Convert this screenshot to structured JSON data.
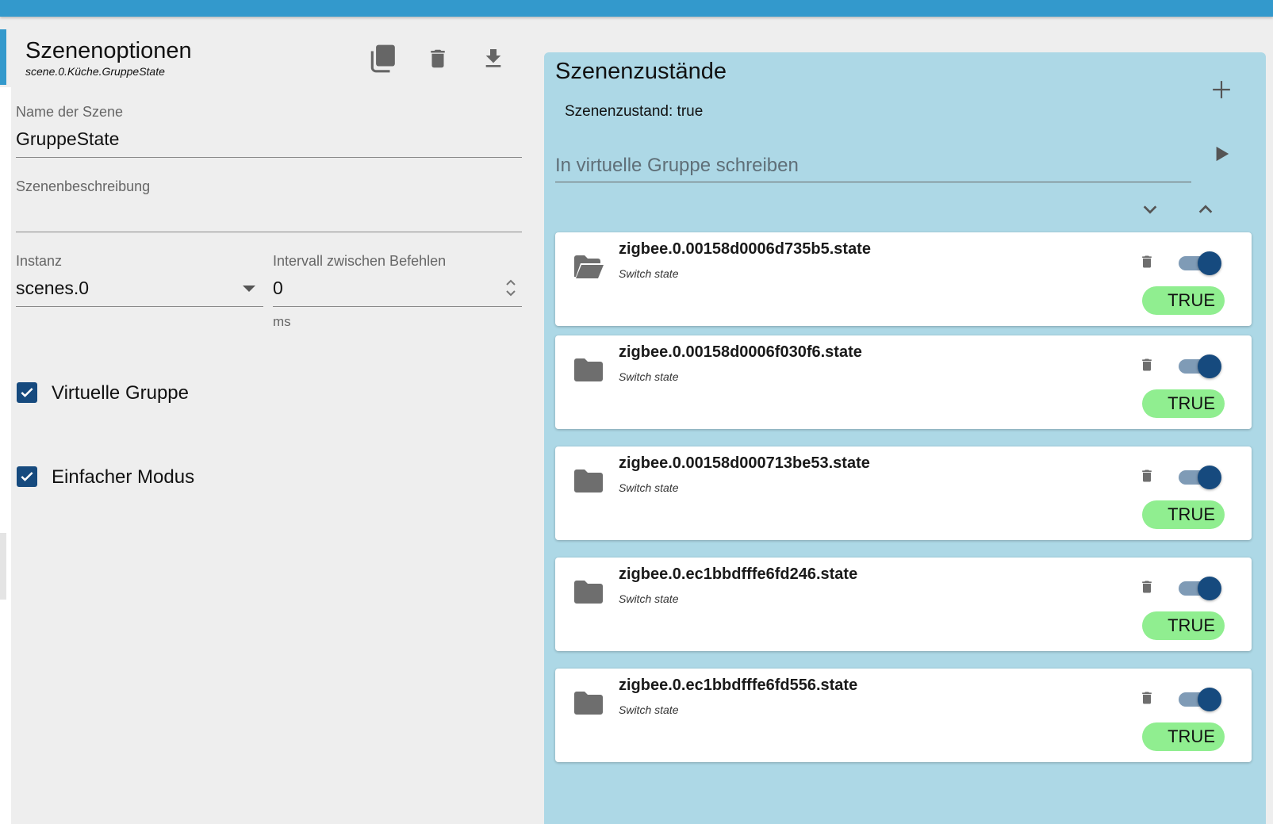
{
  "colors": {
    "topbar": "#3399cc",
    "right_panel_bg": "#add8e6",
    "accent_dark": "#164a7e",
    "true_badge": "#90ee90",
    "page_bg": "#eeeeee"
  },
  "scene_options": {
    "title": "Szenenoptionen",
    "scene_id": "scene.0.Küche.GruppeState",
    "toolbar_icons": [
      "copy-icon",
      "delete-icon",
      "download-icon"
    ],
    "name_label": "Name der Szene",
    "name_value": "GruppeState",
    "description_label": "Szenenbeschreibung",
    "description_value": "",
    "instance_label": "Instanz",
    "instance_value": "scenes.0",
    "interval_label": "Intervall zwischen Befehlen",
    "interval_value": "0",
    "interval_unit": "ms",
    "virtual_group_label": "Virtuelle Gruppe",
    "virtual_group_checked": true,
    "simple_mode_label": "Einfacher Modus",
    "simple_mode_checked": true
  },
  "scene_states": {
    "title": "Szenenzustände",
    "state_text": "Szenenzustand: true",
    "write_placeholder": "In virtuelle Gruppe schreiben",
    "members": [
      {
        "id": "zigbee.0.00158d0006d735b5.state",
        "description": "Switch state",
        "enabled": true,
        "value": "TRUE",
        "icon": "folder-open-icon"
      },
      {
        "id": "zigbee.0.00158d0006f030f6.state",
        "description": "Switch state",
        "enabled": true,
        "value": "TRUE",
        "icon": "folder-icon"
      },
      {
        "id": "zigbee.0.00158d000713be53.state",
        "description": "Switch state",
        "enabled": true,
        "value": "TRUE",
        "icon": "folder-icon"
      },
      {
        "id": "zigbee.0.ec1bbdfffe6fd246.state",
        "description": "Switch state",
        "enabled": true,
        "value": "TRUE",
        "icon": "folder-icon"
      },
      {
        "id": "zigbee.0.ec1bbdfffe6fd556.state",
        "description": "Switch state",
        "enabled": true,
        "value": "TRUE",
        "icon": "folder-icon"
      }
    ]
  }
}
